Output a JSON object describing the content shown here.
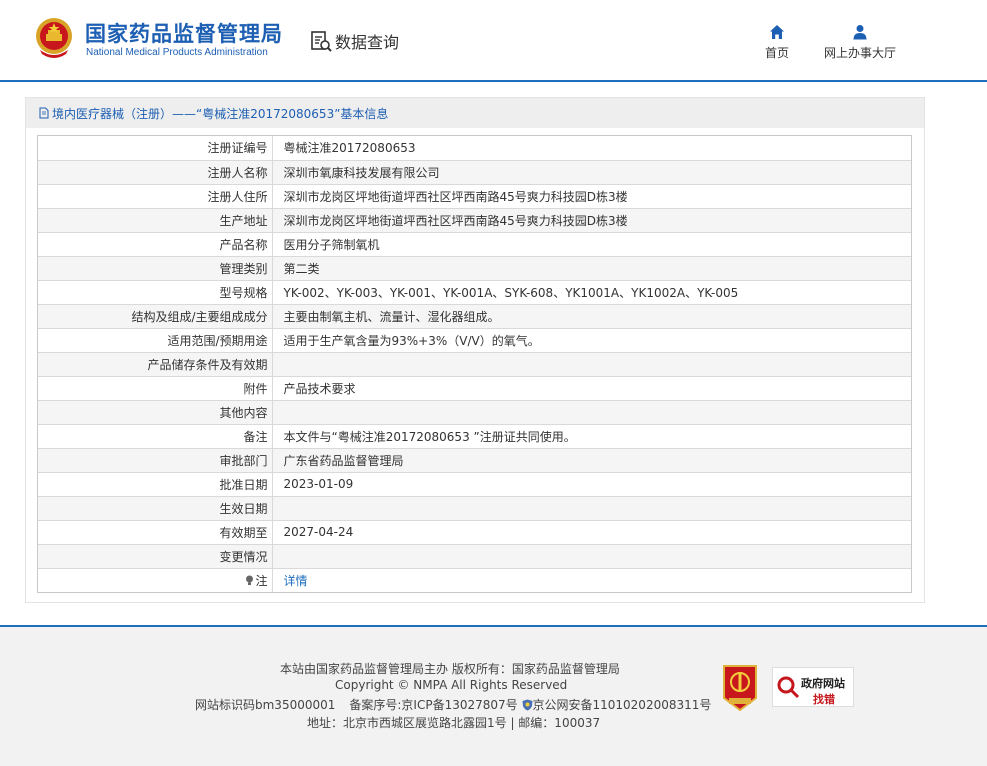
{
  "header": {
    "logo_cn": "国家药品监督管理局",
    "logo_en": "National Medical Products Administration",
    "query_label": "数据查询",
    "nav": [
      {
        "label": "首页"
      },
      {
        "label": "网上办事大厅"
      }
    ]
  },
  "panel": {
    "title": "境内医疗器械（注册）——“粤械注准20172080653”基本信息",
    "rows": [
      {
        "key": "注册证编号",
        "value": "粤械注准20172080653"
      },
      {
        "key": "注册人名称",
        "value": "深圳市氧康科技发展有限公司"
      },
      {
        "key": "注册人住所",
        "value": "深圳市龙岗区坪地街道坪西社区坪西南路45号爽力科技园D栋3楼"
      },
      {
        "key": "生产地址",
        "value": "深圳市龙岗区坪地街道坪西社区坪西南路45号爽力科技园D栋3楼"
      },
      {
        "key": "产品名称",
        "value": "医用分子筛制氧机"
      },
      {
        "key": "管理类别",
        "value": "第二类"
      },
      {
        "key": "型号规格",
        "value": "YK-002、YK-003、YK-001、YK-001A、SYK-608、YK1001A、YK1002A、YK-005"
      },
      {
        "key": "结构及组成/主要组成成分",
        "value": "主要由制氧主机、流量计、湿化器组成。"
      },
      {
        "key": "适用范围/预期用途",
        "value": "适用于生产氧含量为93%+3%（V/V）的氧气。"
      },
      {
        "key": "产品储存条件及有效期",
        "value": ""
      },
      {
        "key": "附件",
        "value": "产品技术要求"
      },
      {
        "key": "其他内容",
        "value": ""
      },
      {
        "key": "备注",
        "value": "本文件与“粤械注准20172080653 ”注册证共同使用。"
      },
      {
        "key": "审批部门",
        "value": "广东省药品监督管理局"
      },
      {
        "key": "批准日期",
        "value": "2023-01-09"
      },
      {
        "key": "生效日期",
        "value": ""
      },
      {
        "key": "有效期至",
        "value": "2027-04-24"
      },
      {
        "key": "变更情况",
        "value": ""
      }
    ],
    "note_key": "注",
    "note_link": "详情"
  },
  "footer": {
    "line1": "本站由国家药品监督管理局主办 版权所有：国家药品监督管理局",
    "line2": "Copyright © NMPA All Rights Reserved",
    "site_code": "网站标识码bm35000001",
    "icp": "备案序号:京ICP备13027807号",
    "police": "京公网安备11010202008311号",
    "line4": "地址：北京市西城区展览路北露园1号 | 邮编：100037",
    "gov_badge_line1": "政府网站",
    "gov_badge_line2": "找错"
  },
  "colors": {
    "brand_blue": "#1d5fb3",
    "link_blue": "#1f6fc0",
    "row_alt": "#f5f5f5"
  }
}
